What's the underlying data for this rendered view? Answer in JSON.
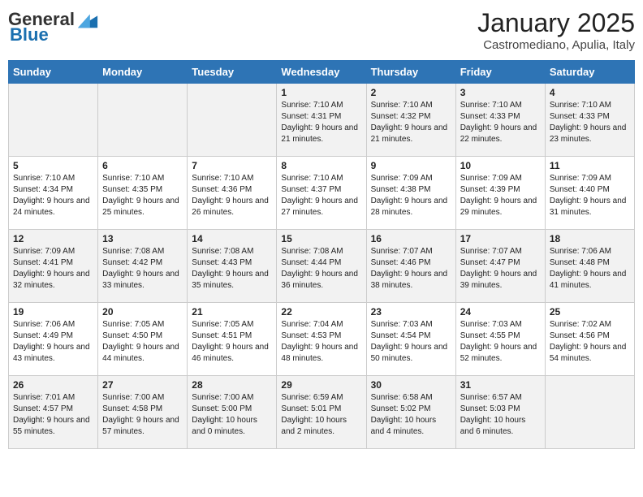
{
  "logo": {
    "general": "General",
    "blue": "Blue"
  },
  "title": "January 2025",
  "subtitle": "Castromediano, Apulia, Italy",
  "days_of_week": [
    "Sunday",
    "Monday",
    "Tuesday",
    "Wednesday",
    "Thursday",
    "Friday",
    "Saturday"
  ],
  "weeks": [
    [
      {
        "day": "",
        "info": ""
      },
      {
        "day": "",
        "info": ""
      },
      {
        "day": "",
        "info": ""
      },
      {
        "day": "1",
        "info": "Sunrise: 7:10 AM\nSunset: 4:31 PM\nDaylight: 9 hours and 21 minutes."
      },
      {
        "day": "2",
        "info": "Sunrise: 7:10 AM\nSunset: 4:32 PM\nDaylight: 9 hours and 21 minutes."
      },
      {
        "day": "3",
        "info": "Sunrise: 7:10 AM\nSunset: 4:33 PM\nDaylight: 9 hours and 22 minutes."
      },
      {
        "day": "4",
        "info": "Sunrise: 7:10 AM\nSunset: 4:33 PM\nDaylight: 9 hours and 23 minutes."
      }
    ],
    [
      {
        "day": "5",
        "info": "Sunrise: 7:10 AM\nSunset: 4:34 PM\nDaylight: 9 hours and 24 minutes."
      },
      {
        "day": "6",
        "info": "Sunrise: 7:10 AM\nSunset: 4:35 PM\nDaylight: 9 hours and 25 minutes."
      },
      {
        "day": "7",
        "info": "Sunrise: 7:10 AM\nSunset: 4:36 PM\nDaylight: 9 hours and 26 minutes."
      },
      {
        "day": "8",
        "info": "Sunrise: 7:10 AM\nSunset: 4:37 PM\nDaylight: 9 hours and 27 minutes."
      },
      {
        "day": "9",
        "info": "Sunrise: 7:09 AM\nSunset: 4:38 PM\nDaylight: 9 hours and 28 minutes."
      },
      {
        "day": "10",
        "info": "Sunrise: 7:09 AM\nSunset: 4:39 PM\nDaylight: 9 hours and 29 minutes."
      },
      {
        "day": "11",
        "info": "Sunrise: 7:09 AM\nSunset: 4:40 PM\nDaylight: 9 hours and 31 minutes."
      }
    ],
    [
      {
        "day": "12",
        "info": "Sunrise: 7:09 AM\nSunset: 4:41 PM\nDaylight: 9 hours and 32 minutes."
      },
      {
        "day": "13",
        "info": "Sunrise: 7:08 AM\nSunset: 4:42 PM\nDaylight: 9 hours and 33 minutes."
      },
      {
        "day": "14",
        "info": "Sunrise: 7:08 AM\nSunset: 4:43 PM\nDaylight: 9 hours and 35 minutes."
      },
      {
        "day": "15",
        "info": "Sunrise: 7:08 AM\nSunset: 4:44 PM\nDaylight: 9 hours and 36 minutes."
      },
      {
        "day": "16",
        "info": "Sunrise: 7:07 AM\nSunset: 4:46 PM\nDaylight: 9 hours and 38 minutes."
      },
      {
        "day": "17",
        "info": "Sunrise: 7:07 AM\nSunset: 4:47 PM\nDaylight: 9 hours and 39 minutes."
      },
      {
        "day": "18",
        "info": "Sunrise: 7:06 AM\nSunset: 4:48 PM\nDaylight: 9 hours and 41 minutes."
      }
    ],
    [
      {
        "day": "19",
        "info": "Sunrise: 7:06 AM\nSunset: 4:49 PM\nDaylight: 9 hours and 43 minutes."
      },
      {
        "day": "20",
        "info": "Sunrise: 7:05 AM\nSunset: 4:50 PM\nDaylight: 9 hours and 44 minutes."
      },
      {
        "day": "21",
        "info": "Sunrise: 7:05 AM\nSunset: 4:51 PM\nDaylight: 9 hours and 46 minutes."
      },
      {
        "day": "22",
        "info": "Sunrise: 7:04 AM\nSunset: 4:53 PM\nDaylight: 9 hours and 48 minutes."
      },
      {
        "day": "23",
        "info": "Sunrise: 7:03 AM\nSunset: 4:54 PM\nDaylight: 9 hours and 50 minutes."
      },
      {
        "day": "24",
        "info": "Sunrise: 7:03 AM\nSunset: 4:55 PM\nDaylight: 9 hours and 52 minutes."
      },
      {
        "day": "25",
        "info": "Sunrise: 7:02 AM\nSunset: 4:56 PM\nDaylight: 9 hours and 54 minutes."
      }
    ],
    [
      {
        "day": "26",
        "info": "Sunrise: 7:01 AM\nSunset: 4:57 PM\nDaylight: 9 hours and 55 minutes."
      },
      {
        "day": "27",
        "info": "Sunrise: 7:00 AM\nSunset: 4:58 PM\nDaylight: 9 hours and 57 minutes."
      },
      {
        "day": "28",
        "info": "Sunrise: 7:00 AM\nSunset: 5:00 PM\nDaylight: 10 hours and 0 minutes."
      },
      {
        "day": "29",
        "info": "Sunrise: 6:59 AM\nSunset: 5:01 PM\nDaylight: 10 hours and 2 minutes."
      },
      {
        "day": "30",
        "info": "Sunrise: 6:58 AM\nSunset: 5:02 PM\nDaylight: 10 hours and 4 minutes."
      },
      {
        "day": "31",
        "info": "Sunrise: 6:57 AM\nSunset: 5:03 PM\nDaylight: 10 hours and 6 minutes."
      },
      {
        "day": "",
        "info": ""
      }
    ]
  ]
}
